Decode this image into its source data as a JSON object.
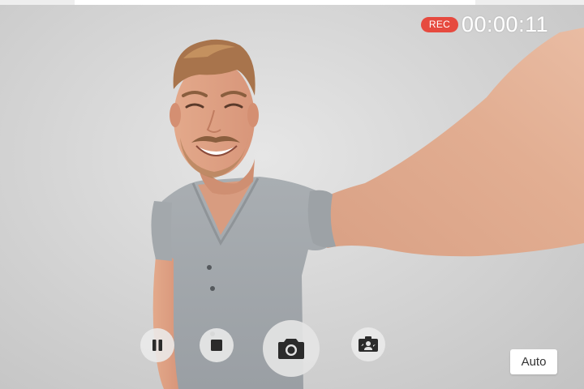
{
  "recording": {
    "badge_label": "REC",
    "timer": "00:00:11",
    "badge_color": "#e64a3f"
  },
  "controls": {
    "pause_icon": "pause-icon",
    "stop_icon": "stop-icon",
    "capture_icon": "camera-icon",
    "switch_icon": "switch-camera-icon",
    "mode_label": "Auto"
  }
}
